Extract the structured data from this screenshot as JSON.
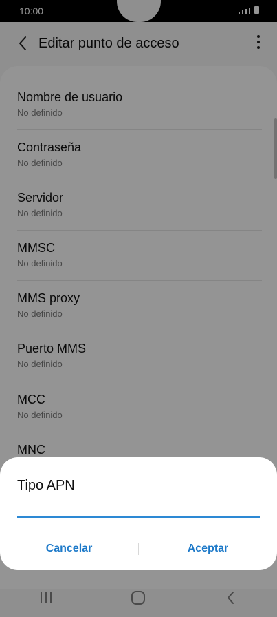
{
  "status_bar": {
    "time": "10:00"
  },
  "header": {
    "title": "Editar punto de acceso",
    "back_icon": "chevron-left-icon",
    "more_icon": "more-vertical-icon"
  },
  "list": {
    "items": [
      {
        "title": "Nombre de usuario",
        "subtitle": "No definido"
      },
      {
        "title": "Contraseña",
        "subtitle": "No definido"
      },
      {
        "title": "Servidor",
        "subtitle": "No definido"
      },
      {
        "title": "MMSC",
        "subtitle": "No definido"
      },
      {
        "title": "MMS proxy",
        "subtitle": "No definido"
      },
      {
        "title": "Puerto MMS",
        "subtitle": "No definido"
      },
      {
        "title": "MCC",
        "subtitle": "No definido"
      },
      {
        "title": "MNC",
        "subtitle": ""
      }
    ]
  },
  "dialog": {
    "title": "Tipo APN",
    "input_value": "",
    "cancel_label": "Cancelar",
    "accept_label": "Aceptar"
  },
  "nav_bar": {
    "recent_icon": "recent-apps-icon",
    "home_icon": "home-icon",
    "back_icon": "back-icon"
  },
  "colors": {
    "accent": "#1e7ac9",
    "input_underline": "#2d89d4",
    "overlay": "rgba(0,0,0,0.42)"
  }
}
